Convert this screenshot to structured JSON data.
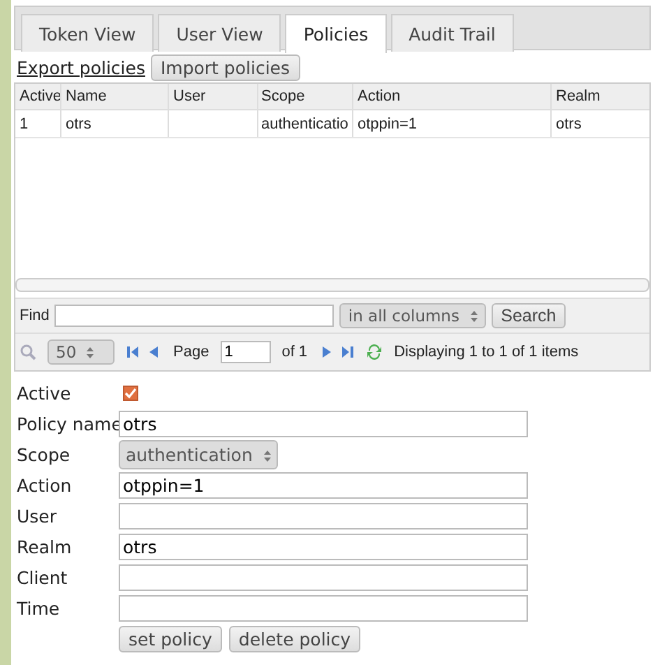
{
  "tabs": [
    {
      "label": "Token View",
      "selected": false
    },
    {
      "label": "User View",
      "selected": false
    },
    {
      "label": "Policies",
      "selected": true
    },
    {
      "label": "Audit Trail",
      "selected": false
    }
  ],
  "actions": {
    "export_link": "Export policies",
    "import_button": "Import policies"
  },
  "table": {
    "columns": [
      "Active",
      "Name",
      "User",
      "Scope",
      "Action",
      "Realm"
    ],
    "rows": [
      [
        "1",
        "otrs",
        "",
        "authenticatio",
        "otppin=1",
        "otrs"
      ]
    ]
  },
  "find": {
    "label": "Find",
    "column_select": "in all columns",
    "search_button": "Search"
  },
  "pager": {
    "page_size": "50",
    "page_label": "Page",
    "page": "1",
    "of": "of 1",
    "status": "Displaying 1 to 1 of 1 items"
  },
  "form": {
    "fields": [
      {
        "label": "Active",
        "kind": "checkbox",
        "checked": true
      },
      {
        "label": "Policy name",
        "kind": "text",
        "value": "otrs"
      },
      {
        "label": "Scope",
        "kind": "select",
        "value": "authentication"
      },
      {
        "label": "Action",
        "kind": "text",
        "value": "otppin=1"
      },
      {
        "label": "User",
        "kind": "text"
      },
      {
        "label": "Realm",
        "kind": "text",
        "value": "otrs"
      },
      {
        "label": "Client",
        "kind": "text"
      },
      {
        "label": "Time",
        "kind": "text"
      }
    ],
    "buttons": [
      "set policy",
      "delete policy"
    ]
  }
}
